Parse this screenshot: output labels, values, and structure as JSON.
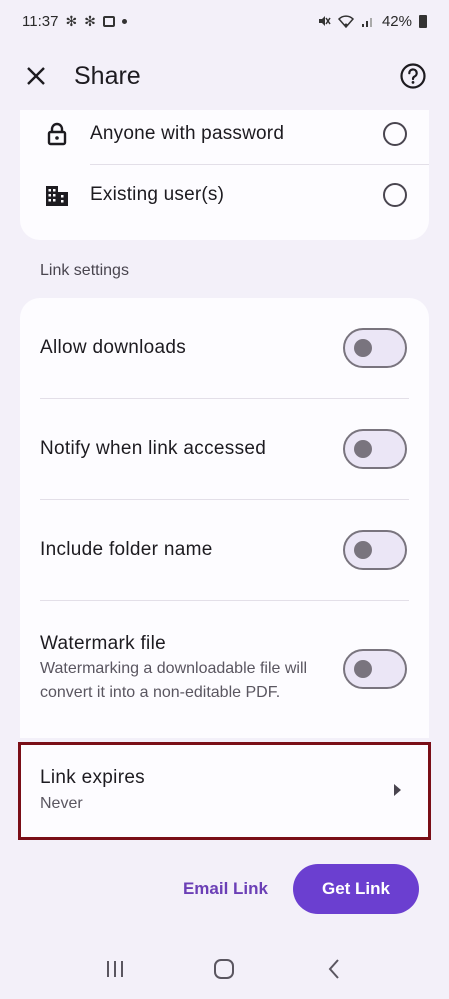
{
  "status_bar": {
    "time": "11:37",
    "battery": "42%"
  },
  "app_bar": {
    "title": "Share"
  },
  "access_options": [
    {
      "label": "Anyone with password",
      "icon": "lock-icon"
    },
    {
      "label": "Existing user(s)",
      "icon": "building-icon"
    }
  ],
  "link_settings": {
    "section_label": "Link settings",
    "items": [
      {
        "label": "Allow downloads",
        "enabled": false
      },
      {
        "label": "Notify when link accessed",
        "enabled": false
      },
      {
        "label": "Include folder name",
        "enabled": false
      },
      {
        "label": "Watermark file",
        "description": "Watermarking a downloadable file will convert it into a non-editable PDF.",
        "enabled": false
      }
    ]
  },
  "link_expires": {
    "label": "Link expires",
    "value": "Never"
  },
  "actions": {
    "email_link": "Email Link",
    "get_link": "Get Link"
  },
  "colors": {
    "accent": "#6b3fd0",
    "highlight": "#7a0e17"
  }
}
